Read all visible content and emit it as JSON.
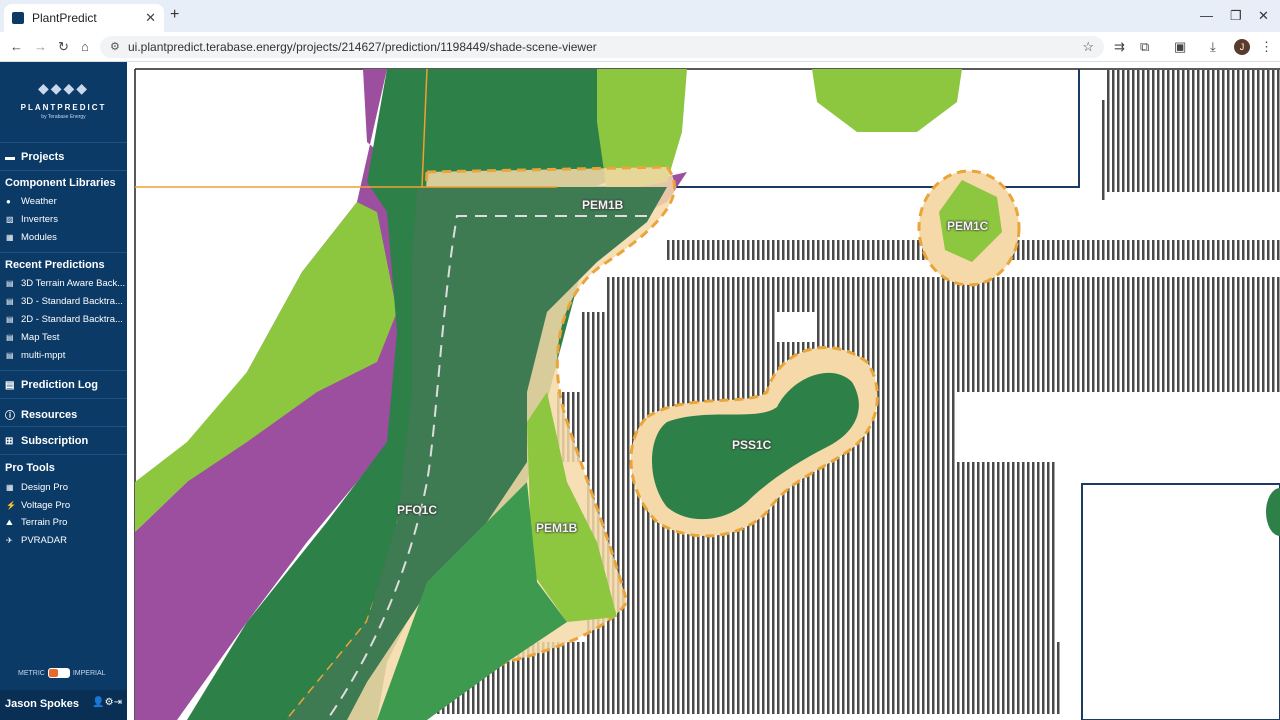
{
  "browser": {
    "tab_title": "PlantPredict",
    "url": "ui.plantpredict.terabase.energy/projects/214627/prediction/1198449/shade-scene-viewer",
    "profile_initial": "J"
  },
  "brand": {
    "logo_name": "PLANTPREDICT",
    "logo_byline": "by Terabase Energy"
  },
  "sidebar": {
    "projects": "Projects",
    "component_libraries": {
      "title": "Component Libraries",
      "items": [
        "Weather",
        "Inverters",
        "Modules"
      ]
    },
    "recent_predictions": {
      "title": "Recent Predictions",
      "items": [
        "3D Terrain Aware Back...",
        "3D - Standard Backtra...",
        "2D - Standard Backtra...",
        "Map Test",
        "multi-mppt"
      ]
    },
    "prediction_log": "Prediction Log",
    "resources": "Resources",
    "subscription": "Subscription",
    "pro_tools": {
      "title": "Pro Tools",
      "items": [
        "Design Pro",
        "Voltage Pro",
        "Terrain Pro",
        "PVRADAR"
      ]
    },
    "units": {
      "metric": "METRIC",
      "imperial": "IMPERIAL"
    },
    "user_name": "Jason Spokes"
  },
  "map": {
    "labels": {
      "pem1b_top": "PEM1B",
      "pem1c": "PEM1C",
      "pss1c": "PSS1C",
      "pfo1c": "PFO1C",
      "pem1b_bottom": "PEM1B"
    },
    "colors": {
      "purple": "#9b4f9e",
      "dark_green": "#2e8049",
      "mid_green": "#3e9a4e",
      "light_green": "#8dc63f",
      "buffer": "#f6d9a8",
      "dashed_border": "#e9a53a",
      "panels": "#4a4a4a",
      "boundary": "#1c3b63"
    }
  }
}
